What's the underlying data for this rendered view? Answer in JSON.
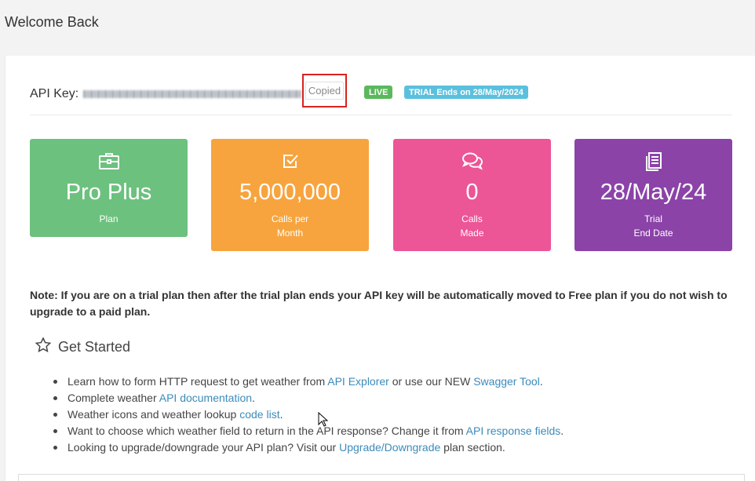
{
  "header": {
    "title": "Welcome Back"
  },
  "api": {
    "label": "API Key:",
    "copy_button_label": "Copied",
    "status_badge": "LIVE",
    "trial_badge": "TRIAL Ends on 28/May/2024"
  },
  "cards": [
    {
      "value": "Pro Plus",
      "caption_line1": "Plan",
      "caption_line2": "",
      "icon": "briefcase-icon",
      "color": "#6cc17e"
    },
    {
      "value": "5,000,000",
      "caption_line1": "Calls per",
      "caption_line2": "Month",
      "icon": "checkbox-icon",
      "color": "#f7a43e"
    },
    {
      "value": "0",
      "caption_line1": "Calls",
      "caption_line2": "Made",
      "icon": "chat-bubbles-icon",
      "color": "#ec5596"
    },
    {
      "value": "28/May/24",
      "caption_line1": "Trial",
      "caption_line2": "End Date",
      "icon": "document-icon",
      "color": "#8b43a8"
    }
  ],
  "note": "Note: If you are on a trial plan then after the trial plan ends your API key will be automatically moved to Free plan if you do not wish to upgrade to a paid plan.",
  "get_started": {
    "title": "Get Started",
    "icon": "star-outline-icon",
    "items": [
      {
        "before": "Learn how to form HTTP request to get weather from ",
        "link1": "API Explorer",
        "middle": " or use our NEW ",
        "link2": "Swagger Tool",
        "after": "."
      },
      {
        "before": "Complete weather ",
        "link1": "API documentation",
        "after": "."
      },
      {
        "before": "Weather icons and weather lookup ",
        "link1": "code list",
        "after": "."
      },
      {
        "before": "Want to choose which weather field to return in the API response? Change it from ",
        "link1": "API response fields",
        "after": "."
      },
      {
        "before": "Looking to upgrade/downgrade your API plan? Visit our ",
        "link1": "Upgrade/Downgrade",
        "after": " plan section."
      }
    ]
  },
  "colors": {
    "live_badge": "#5cb85c",
    "trial_badge": "#5bc0de",
    "link": "#3b8bba",
    "highlight_border": "#d9231f"
  }
}
